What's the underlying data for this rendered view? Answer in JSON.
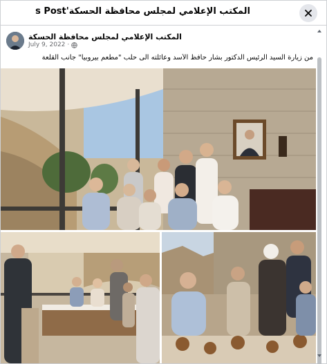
{
  "dialog": {
    "title": "المكتب الإعلامي لمجلس محافظة الحسكة's Post"
  },
  "post": {
    "page_name": "المكتب الإعلامي لمجلس محافظة الحسكة",
    "date": "July 9, 2022",
    "privacy_icon": "globe-icon",
    "text": "من زيارة السيد الرئيس الدكتور بشار حافظ  الأسد وعائلته  الى حلب \"مطعم بيروبيا\" جانب القلعة"
  },
  "icons": {
    "close": "close-icon",
    "scroll_up": "chevron-up-icon",
    "scroll_down": "chevron-down-icon"
  },
  "colors": {
    "scroll_thumb": "#bcc0c4",
    "meta_text": "#65676b",
    "close_bg": "#e4e6eb"
  }
}
